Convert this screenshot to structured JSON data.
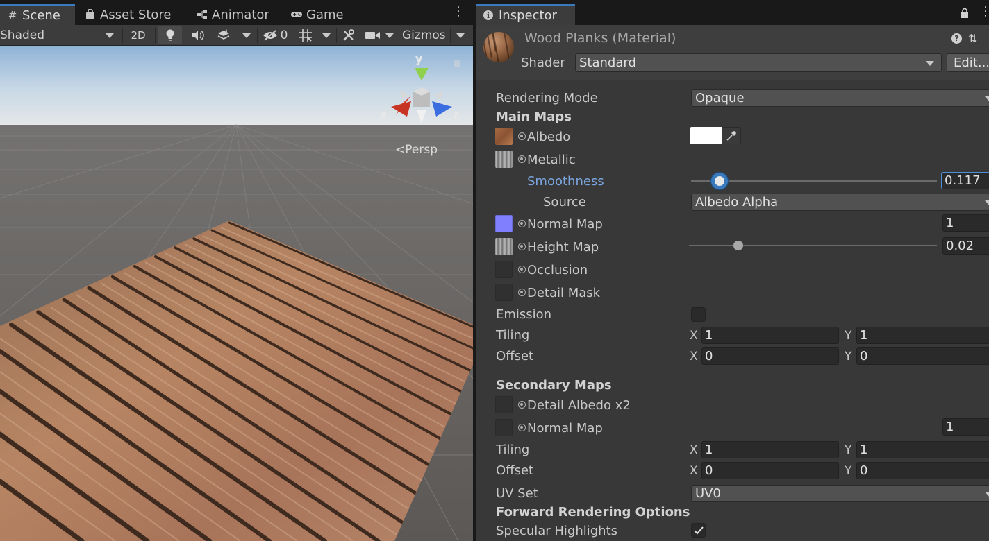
{
  "scene": {
    "tabs": [
      {
        "label": "Scene",
        "icon": "grid-hash-icon"
      },
      {
        "label": "Asset Store",
        "icon": "shopping-bag-icon"
      },
      {
        "label": "Animator",
        "icon": "animator-icon"
      },
      {
        "label": "Game",
        "icon": "gamepad-icon"
      }
    ],
    "toolbar": {
      "shading_mode": "Shaded",
      "mode_2d": "2D",
      "hidden_count": "0",
      "gizmos": "Gizmos"
    },
    "gizmo_axes": {
      "x": "x",
      "y": "y",
      "z": "z"
    },
    "projection": "Persp"
  },
  "inspector": {
    "tab_label": "Inspector",
    "material": {
      "title": "Wood Planks (Material)",
      "shader_label": "Shader",
      "shader_value": "Standard",
      "edit_label": "Edit..."
    },
    "rendering_mode": {
      "label": "Rendering Mode",
      "value": "Opaque"
    },
    "main_maps": {
      "heading": "Main Maps",
      "albedo": {
        "label": "Albedo",
        "color": "#ffffff"
      },
      "metallic": {
        "label": "Metallic"
      },
      "smoothness": {
        "label": "Smoothness",
        "value": "0.117",
        "fraction": 0.117
      },
      "source": {
        "label": "Source",
        "value": "Albedo Alpha"
      },
      "normal_map": {
        "label": "Normal Map",
        "value": "1"
      },
      "height_map": {
        "label": "Height Map",
        "value": "0.02",
        "fraction": 0.2
      },
      "occlusion": {
        "label": "Occlusion"
      },
      "detail_mask": {
        "label": "Detail Mask"
      }
    },
    "emission": {
      "label": "Emission",
      "checked": false
    },
    "main_tiling": {
      "label": "Tiling",
      "x_label": "X",
      "x": "1",
      "y_label": "Y",
      "y": "1"
    },
    "main_offset": {
      "label": "Offset",
      "x_label": "X",
      "x": "0",
      "y_label": "Y",
      "y": "0"
    },
    "secondary_maps": {
      "heading": "Secondary Maps",
      "detail_albedo": {
        "label": "Detail Albedo x2"
      },
      "normal_map": {
        "label": "Normal Map",
        "value": "1"
      }
    },
    "secondary_tiling": {
      "label": "Tiling",
      "x_label": "X",
      "x": "1",
      "y_label": "Y",
      "y": "1"
    },
    "secondary_offset": {
      "label": "Offset",
      "x_label": "X",
      "x": "0",
      "y_label": "Y",
      "y": "0"
    },
    "uv_set": {
      "label": "UV Set",
      "value": "UV0"
    },
    "forward_rendering": {
      "heading": "Forward Rendering Options",
      "specular_highlights": {
        "label": "Specular Highlights",
        "checked": true
      }
    }
  },
  "colors": {
    "accent": "#3a79bb",
    "panel_bg": "#383838",
    "highlight_label": "#7ba7e0"
  }
}
